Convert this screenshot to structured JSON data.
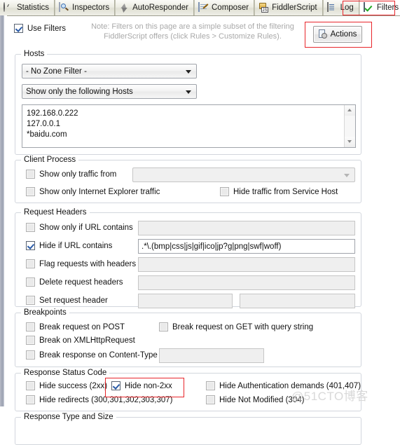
{
  "tabs": [
    {
      "label": "Statistics",
      "icon": "clock-icon",
      "active": false
    },
    {
      "label": "Inspectors",
      "icon": "magnifier-icon",
      "active": false
    },
    {
      "label": "AutoResponder",
      "icon": "lightning-icon",
      "active": false
    },
    {
      "label": "Composer",
      "icon": "notepad-pencil-icon",
      "active": false
    },
    {
      "label": "FiddlerScript",
      "icon": "js-script-icon",
      "active": false
    },
    {
      "label": "Log",
      "icon": "log-document-icon",
      "active": false
    },
    {
      "label": "Filters",
      "icon": "green-check-icon",
      "active": true
    }
  ],
  "toolbar": {
    "use_filters_label": "Use Filters",
    "use_filters_checked": true,
    "note_line1": "Note: Filters on this page are a simple subset of the filtering",
    "note_line2": "FiddlerScript offers (click Rules > Customize Rules).",
    "actions_label": "Actions",
    "actions_icon": "page-gear-icon"
  },
  "hosts": {
    "legend": "Hosts",
    "zone_filter_value": "- No Zone Filter -",
    "host_mode_value": "Show only the following Hosts",
    "host_list": "192.168.0.222\n127.0.0.1\n*baidu.com"
  },
  "client_process": {
    "legend": "Client Process",
    "show_only_traffic_from_label": "Show only traffic from",
    "show_only_traffic_from_checked": false,
    "process_combo_value": "",
    "show_only_ie_label": "Show only Internet Explorer traffic",
    "show_only_ie_checked": false,
    "hide_service_host_label": "Hide traffic from Service Host",
    "hide_service_host_checked": false
  },
  "request_headers": {
    "legend": "Request Headers",
    "rows": [
      {
        "label": "Show only if URL contains",
        "checked": false,
        "value": ""
      },
      {
        "label": "Hide if URL contains",
        "checked": true,
        "value": ".*\\.(bmp|css|js|gif|ico|jp?g|png|swf|woff)"
      },
      {
        "label": "Flag requests with headers",
        "checked": false,
        "value": ""
      },
      {
        "label": "Delete request headers",
        "checked": false,
        "value": ""
      }
    ],
    "set_request_header_label": "Set request header",
    "set_request_header_checked": false,
    "set_request_header_name": "",
    "set_request_header_value": ""
  },
  "breakpoints": {
    "legend": "Breakpoints",
    "break_post_label": "Break request on POST",
    "break_post_checked": false,
    "break_get_query_label": "Break request on GET with query string",
    "break_get_query_checked": false,
    "break_xhr_label": "Break on XMLHttpRequest",
    "break_xhr_checked": false,
    "break_content_type_label": "Break response on Content-Type",
    "break_content_type_checked": false,
    "break_content_type_value": ""
  },
  "response_status": {
    "legend": "Response Status Code",
    "hide_success_label": "Hide success (2xx)",
    "hide_success_checked": false,
    "hide_non2xx_label": "Hide non-2xx",
    "hide_non2xx_checked": true,
    "hide_auth_label": "Hide Authentication demands (401,407)",
    "hide_auth_checked": false,
    "hide_redirects_label": "Hide redirects (300,301,302,303,307)",
    "hide_redirects_checked": false,
    "hide_not_modified_label": "Hide Not Modified (304)",
    "hide_not_modified_checked": false
  },
  "response_type": {
    "legend": "Response Type and Size"
  },
  "watermark": "@51CTO博客",
  "colors": {
    "highlight": "#e8252a",
    "accent_check": "#2a5ba8",
    "note_text": "#a9a9a9"
  }
}
